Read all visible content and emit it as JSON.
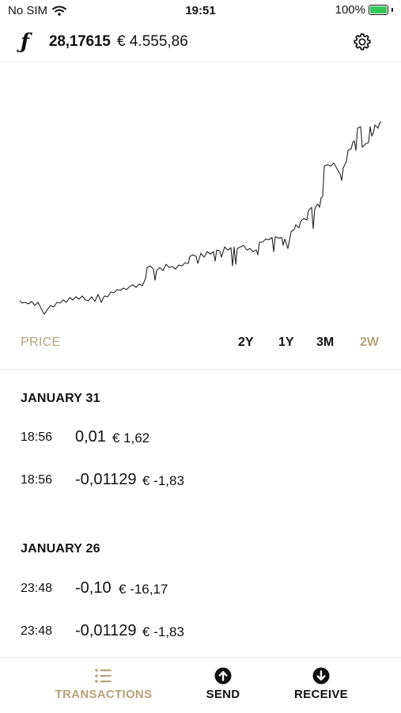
{
  "status_bar": {
    "carrier": "No SIM",
    "time": "19:51",
    "battery": "100%",
    "battery_level": 1.0,
    "battery_color": "#34c759"
  },
  "header": {
    "currency_symbol": "ƒ",
    "balance": "28,17615",
    "fiat_balance": "€ 4.555,86",
    "settings_icon": "gear-icon"
  },
  "chart": {
    "range_label": "PRICE",
    "ranges": [
      "2Y",
      "1Y",
      "3M",
      "2W"
    ],
    "active_range": "2W",
    "accent": "#b8a377"
  },
  "transactions": [
    {
      "date": "JANUARY 31",
      "items": [
        {
          "time": "18:56",
          "amount": "0,01",
          "fiat": "€ 1,62"
        },
        {
          "time": "18:56",
          "amount": "-0,01129",
          "fiat": "€ -1,83"
        }
      ]
    },
    {
      "date": "JANUARY 26",
      "items": [
        {
          "time": "23:48",
          "amount": "-0,10",
          "fiat": "€ -16,17"
        },
        {
          "time": "23:48",
          "amount": "-0,01129",
          "fiat": "€ -1,83"
        }
      ]
    }
  ],
  "tabbar": {
    "items": [
      {
        "label": "TRANSACTIONS",
        "icon": "list-icon",
        "active": true
      },
      {
        "label": "SEND",
        "icon": "arrow-up-circle-icon",
        "active": false
      },
      {
        "label": "RECEIVE",
        "icon": "arrow-down-circle-icon",
        "active": false
      }
    ]
  }
}
